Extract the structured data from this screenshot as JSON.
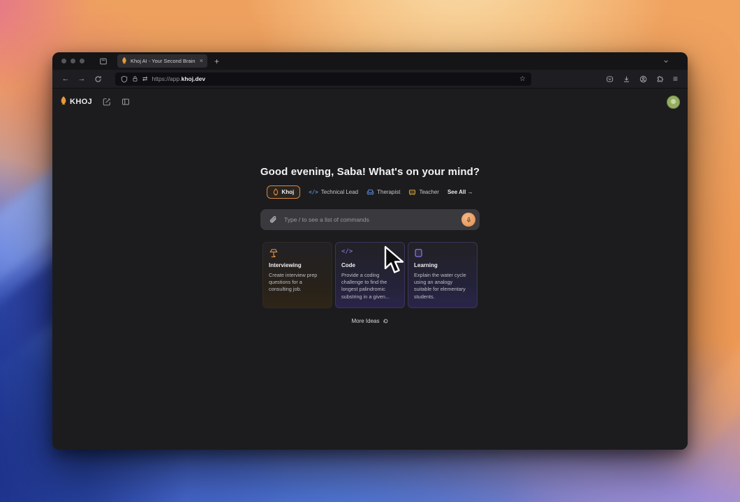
{
  "colors": {
    "accent_orange": "#d9893f",
    "icon_blue": "#5b8bd8",
    "teacher_yellow": "#d4a43c",
    "purple": "#7b6fd0",
    "avatar_green": "#94ad5e"
  },
  "browser": {
    "tab_title": "Khoj AI - Your Second Brain",
    "close_glyph": "×",
    "new_tab_glyph": "+",
    "back_glyph": "←",
    "forward_glyph": "→",
    "swap_glyph": "⇄",
    "star_glyph": "☆",
    "menu_glyph": "≡",
    "url_prefix": "https://app.",
    "url_domain": "khoj.dev"
  },
  "app": {
    "logo_text": "KHOJ",
    "greeting": "Good evening, Saba! What's on your mind?",
    "code_glyph": "</>",
    "agents": [
      {
        "name": "Khoj"
      },
      {
        "name": "Technical Lead"
      },
      {
        "name": "Therapist"
      },
      {
        "name": "Teacher"
      }
    ],
    "see_all": "See All →",
    "chat_input": {
      "placeholder": "Type / to see a list of commands"
    },
    "suggestions": [
      {
        "title": "Interviewing",
        "body": "Create interview prep questions for a consulting job."
      },
      {
        "title": "Code",
        "body": "Provide a coding challenge to find the longest palindromic substring in a given..."
      },
      {
        "title": "Learning",
        "body": "Explain the water cycle using an analogy suitable for elementary students."
      }
    ],
    "more_ideas_label": "More Ideas"
  }
}
